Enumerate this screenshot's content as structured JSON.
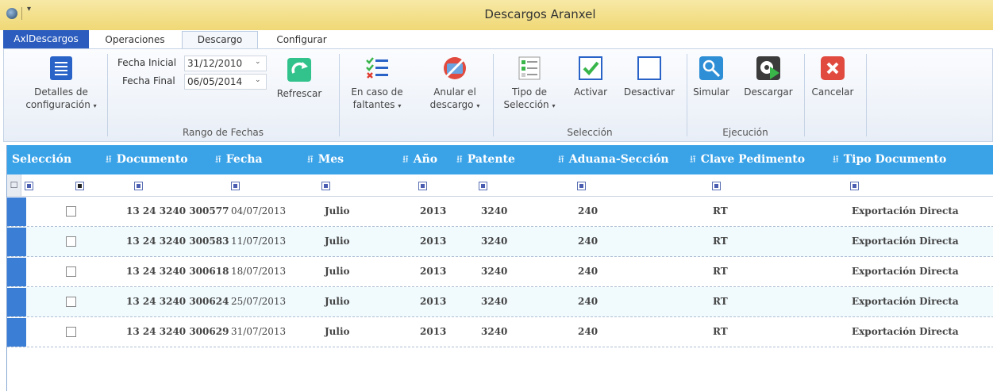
{
  "window": {
    "title": "Descargos Aranxel",
    "qa_glyph": "¦ ▾"
  },
  "tabs": {
    "app": "AxlDescargos",
    "items": [
      "Operaciones",
      "Descargo",
      "Configurar"
    ]
  },
  "ribbon": {
    "detalles": {
      "line1": "Detalles de",
      "line2": "configuración",
      "caret": "▾"
    },
    "fecha_inicial": {
      "label": "Fecha Inicial",
      "value": "31/12/2010"
    },
    "fecha_final": {
      "label": "Fecha Final",
      "value": "06/05/2014"
    },
    "refrescar": "Refrescar",
    "rango_label": "Rango de Fechas",
    "faltantes": {
      "line1": "En caso de",
      "line2": "faltantes",
      "caret": "▾"
    },
    "anular": {
      "line1": "Anular el",
      "line2": "descargo",
      "caret": "▾"
    },
    "tipo_sel": {
      "line1": "Tipo de",
      "line2": "Selección",
      "caret": "▾"
    },
    "activar": "Activar",
    "desactivar": "Desactivar",
    "seleccion_label": "Selección",
    "simular": "Simular",
    "descargar": "Descargar",
    "ejecucion_label": "Ejecución",
    "cancelar": "Cancelar",
    "dropdown_arrow": "⌄"
  },
  "grid": {
    "pin_glyph": "⭿",
    "headers": {
      "seleccion": "Selección",
      "documento": "Documento",
      "fecha": "Fecha",
      "mes": "Mes",
      "anio": "Año",
      "patente": "Patente",
      "aduana": "Aduana-Sección",
      "clave": "Clave Pedimento",
      "tipo": "Tipo Documento"
    },
    "filter_glyph": "☐",
    "rows": [
      {
        "documento": "13 24 3240 300577",
        "fecha": "04/07/2013",
        "mes": "Julio",
        "anio": "2013",
        "patente": "3240",
        "aduana": "240",
        "clave": "RT",
        "tipo": "Exportación Directa"
      },
      {
        "documento": "13 24 3240 300583",
        "fecha": "11/07/2013",
        "mes": "Julio",
        "anio": "2013",
        "patente": "3240",
        "aduana": "240",
        "clave": "RT",
        "tipo": "Exportación Directa"
      },
      {
        "documento": "13 24 3240 300618",
        "fecha": "18/07/2013",
        "mes": "Julio",
        "anio": "2013",
        "patente": "3240",
        "aduana": "240",
        "clave": "RT",
        "tipo": "Exportación Directa"
      },
      {
        "documento": "13 24 3240 300624",
        "fecha": "25/07/2013",
        "mes": "Julio",
        "anio": "2013",
        "patente": "3240",
        "aduana": "240",
        "clave": "RT",
        "tipo": "Exportación Directa"
      },
      {
        "documento": "13 24 3240 300629",
        "fecha": "31/07/2013",
        "mes": "Julio",
        "anio": "2013",
        "patente": "3240",
        "aduana": "240",
        "clave": "RT",
        "tipo": "Exportación Directa"
      }
    ]
  }
}
